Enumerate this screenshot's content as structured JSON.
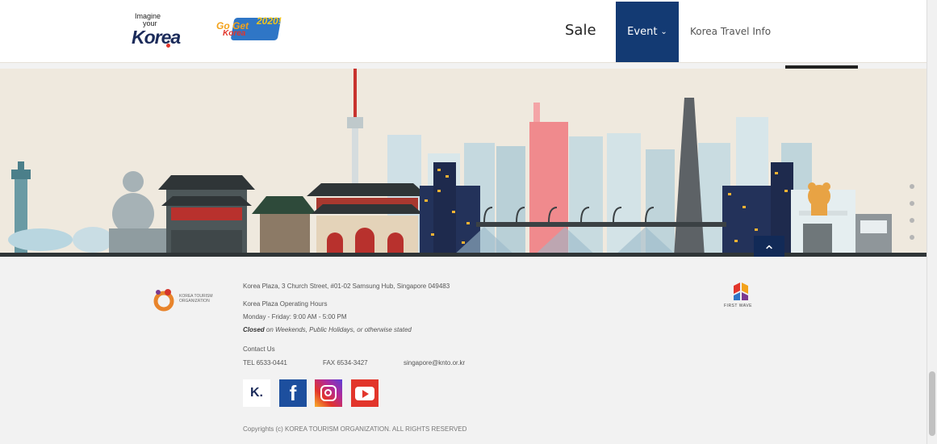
{
  "header": {
    "logo_line1": "Imagine",
    "logo_line2": "your",
    "logo_line3": "Korea",
    "campaign_t1": "Go Get",
    "campaign_t2": "Korea",
    "campaign_t3": "2020!",
    "campaign_t4": "",
    "nav": {
      "sale": "Sale",
      "event": "Event",
      "travel_info": "Korea Travel Info"
    }
  },
  "footer": {
    "org_logo_text": "KOREA TOURISM ORGANIZATION",
    "address": "Korea Plaza, 3 Church Street, #01-02 Samsung Hub, Singapore 049483",
    "hours_title": "Korea Plaza Operating Hours",
    "hours": "Monday - Friday: 9:00 AM - 5:00 PM",
    "closed_label": "Closed",
    "closed_rest": " on Weekends, Public Holidays, or otherwise stated",
    "contact_title": "Contact Us",
    "tel": "TEL 6533-0441",
    "fax": "FAX 6534-3427",
    "email": "singapore@knto.or.kr",
    "copyright": "Copyrights (c) KOREA TOURISM ORGANIZATION. ALL RIGHTS RESERVED",
    "partner_logo_text": "FIRST WAVE",
    "social_k": "K."
  },
  "colors": {
    "nav_active": "#133a73",
    "skyline_bg": "#efe9de",
    "footer_bg": "#f2f2f2"
  }
}
